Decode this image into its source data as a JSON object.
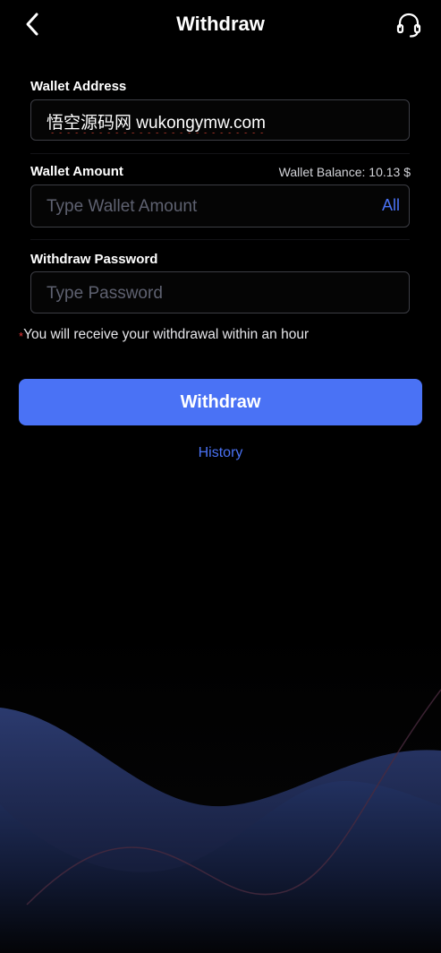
{
  "header": {
    "title": "Withdraw",
    "back_icon": "chevron-left-icon",
    "support_icon": "headset-icon"
  },
  "form": {
    "wallet_address": {
      "label": "Wallet Address",
      "value": "悟空源码网 wukongymw.com"
    },
    "wallet_amount": {
      "label": "Wallet Amount",
      "balance_text": "Wallet Balance: 10.13 $",
      "placeholder": "Type Wallet Amount",
      "all_label": "All"
    },
    "withdraw_password": {
      "label": "Withdraw Password",
      "placeholder": "Type Password"
    },
    "notice_star": "*",
    "notice": "You will receive your withdrawal within an hour",
    "submit_label": "Withdraw",
    "history_label": "History"
  },
  "colors": {
    "accent": "#4a72f5",
    "background": "#000000",
    "error_star": "#e5363a"
  }
}
